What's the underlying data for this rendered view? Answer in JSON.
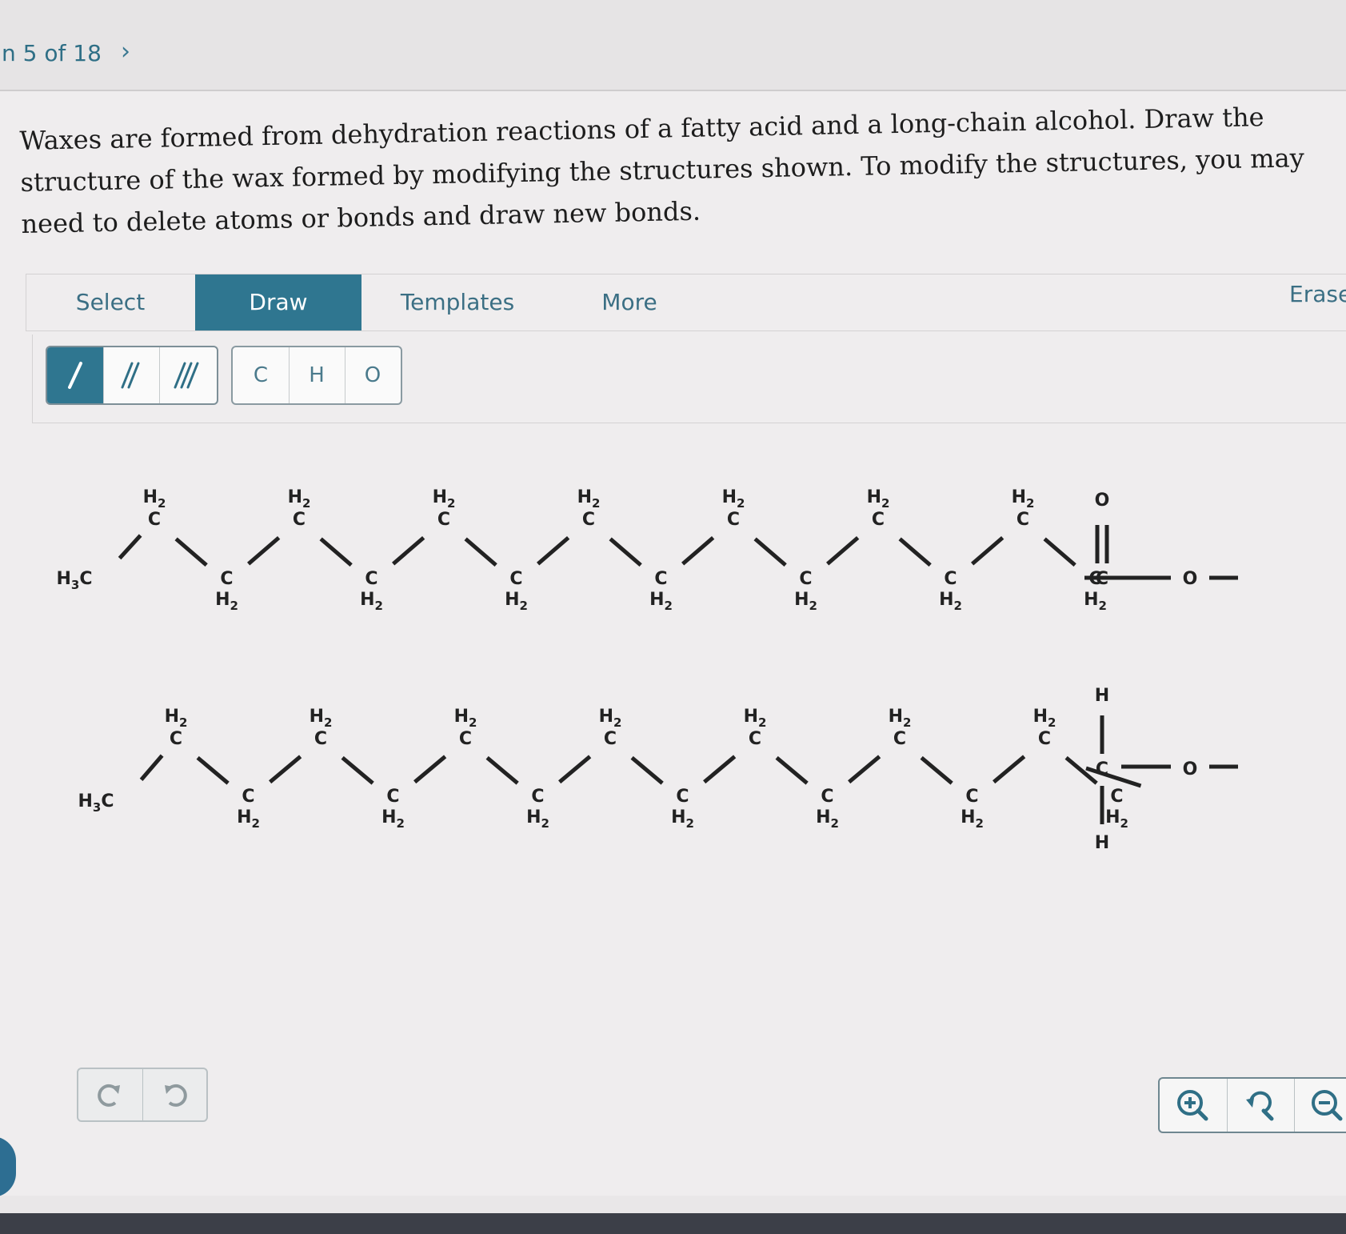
{
  "nav": {
    "question_counter": "n 5 of 18",
    "next_icon": "chevron-right-icon"
  },
  "question_text": "Waxes are formed from dehydration reactions of a fatty acid and a long-chain alcohol. Draw the structure of the wax formed by modifying the structures shown. To modify the structures, you may need to delete atoms or bonds and draw new bonds.",
  "tabs": {
    "select": "Select",
    "draw": "Draw",
    "templates": "Templates",
    "more": "More",
    "erase": "Erase"
  },
  "bond_tools": {
    "single_icon": "single-bond-icon",
    "double_icon": "double-bond-icon",
    "triple_icon": "triple-bond-icon"
  },
  "atom_tools": {
    "carbon": "C",
    "hydrogen": "H",
    "oxygen": "O"
  },
  "colors": {
    "accent": "#2f7690",
    "link": "#3b6f84",
    "bond": "#222222"
  },
  "molecule_labels": {
    "methyl": "H3C",
    "methylene": "H2C",
    "carbon": "C",
    "oxygen": "O",
    "hydrogen": "H"
  },
  "controls": {
    "undo_icon": "undo-icon",
    "redo_icon": "redo-icon",
    "zoom_in_icon": "zoom-in-icon",
    "zoom_reset_icon": "zoom-reset-icon",
    "zoom_out_icon": "zoom-out-icon"
  }
}
